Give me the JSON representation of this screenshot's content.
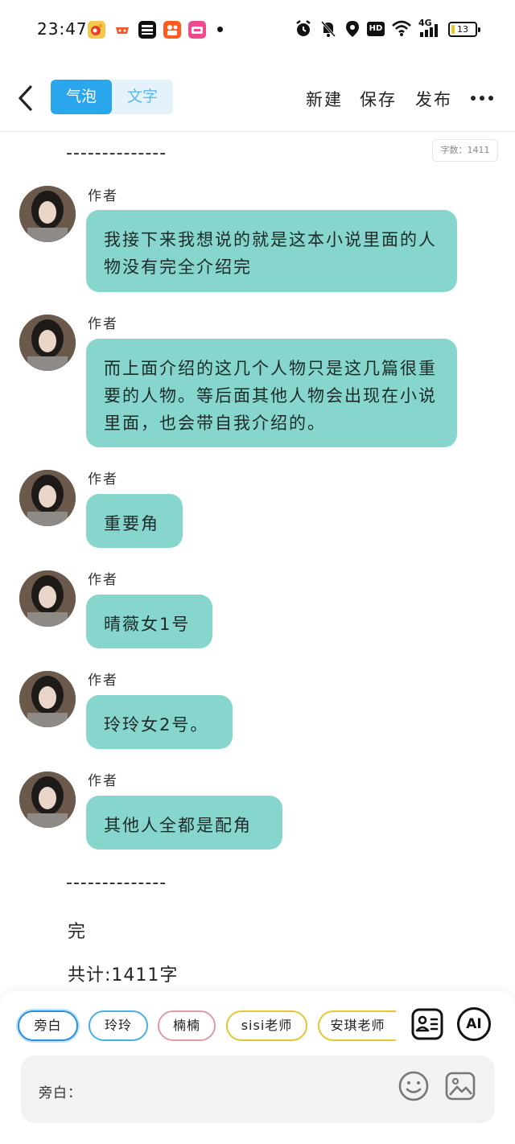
{
  "status_bar": {
    "time": "23:47",
    "battery": "13",
    "battery_level": 0.13,
    "network": "4G",
    "hd": "HD",
    "icons": [
      "weibo-icon",
      "game-icon",
      "douyin-app-icon",
      "kuaishou-icon",
      "music-app-icon",
      "alarm-icon",
      "mute-icon",
      "location-icon",
      "wifi-icon",
      "signal-icon",
      "battery-icon"
    ]
  },
  "header": {
    "back_icon": "chevron-left-icon",
    "tabs": [
      {
        "label": "气泡",
        "active": true
      },
      {
        "label": "文字",
        "active": false
      }
    ],
    "actions": {
      "new": "新建",
      "save": "保存",
      "publish": "发布"
    },
    "more_icon": "more-horizontal-icon"
  },
  "word_count": "字数：1411",
  "divider": "--------------",
  "messages": [
    {
      "author": "作者",
      "text": "我接下来我想说的就是这本小说里面的人物没有完全介绍完"
    },
    {
      "author": "作者",
      "text": "而上面介绍的这几个人物只是这几篇很重要的人物。等后面其他人物会出现在小说里面，也会带自我介绍的。"
    },
    {
      "author": "作者",
      "text": "重要角"
    },
    {
      "author": "作者",
      "text": "晴薇女1号"
    },
    {
      "author": "作者",
      "text": "玲玲女2号。"
    },
    {
      "author": "作者",
      "text": "其他人全都是配角"
    }
  ],
  "end_divider": "--------------",
  "end_text": "完",
  "total_text": "共计:1411字",
  "roles": [
    {
      "label": "旁白",
      "color": "#2a8fe0",
      "selected": true
    },
    {
      "label": "玲玲",
      "color": "#48aee6",
      "selected": false
    },
    {
      "label": "楠楠",
      "color": "#e29aa6",
      "selected": false
    },
    {
      "label": "sisi老师",
      "color": "#e6c532",
      "selected": false
    },
    {
      "label": "安琪老师",
      "color": "#e6c532",
      "selected": false
    }
  ],
  "role_buttons": [
    "contact-card-icon",
    "ai-icon"
  ],
  "ai_label": "AI",
  "input": {
    "label": "旁白：",
    "placeholder": "",
    "value": ""
  },
  "input_icons": [
    "emoji-icon",
    "image-icon"
  ]
}
